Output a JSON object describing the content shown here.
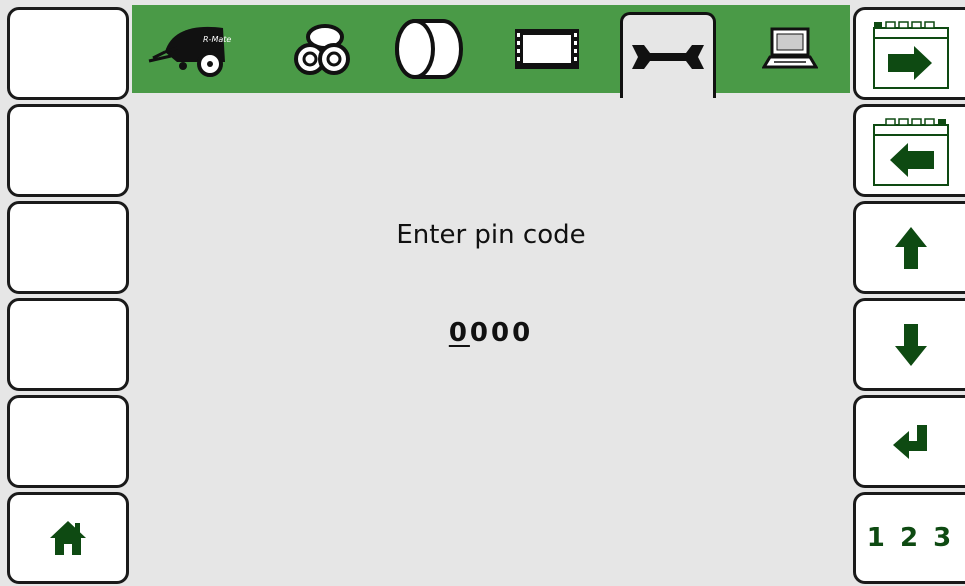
{
  "top_tabs": [
    {
      "name": "tab-baler",
      "icon": "baler-icon",
      "label": "R-Mate",
      "active": false
    },
    {
      "name": "tab-bales",
      "icon": "bales-stack-icon",
      "active": false
    },
    {
      "name": "tab-bale",
      "icon": "bale-icon",
      "active": false
    },
    {
      "name": "tab-display",
      "icon": "film-display-icon",
      "active": false
    },
    {
      "name": "tab-service",
      "icon": "wrench-icon",
      "active": true
    },
    {
      "name": "tab-computer",
      "icon": "laptop-icon",
      "active": false
    }
  ],
  "main": {
    "title": "Enter pin code",
    "pin_digits": [
      "0",
      "0",
      "0",
      "0"
    ],
    "cursor_index": 0
  },
  "right_keys": {
    "numeric_label": "1 2 3"
  },
  "colors": {
    "accent_green": "#4a9a47",
    "icon_dark_green": "#0e4a12",
    "background": "#e6e6e6"
  }
}
